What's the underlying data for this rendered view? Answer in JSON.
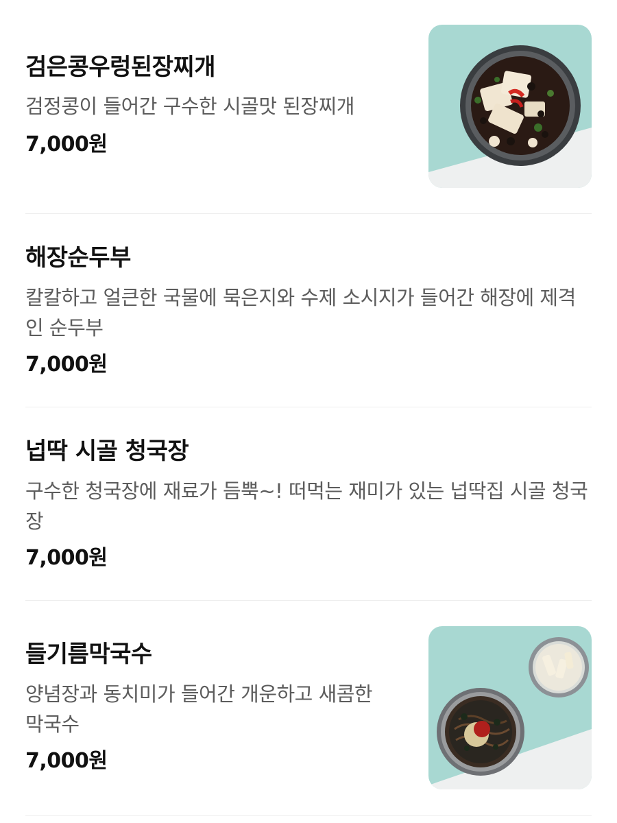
{
  "menu": {
    "items": [
      {
        "name": "검은콩우렁된장찌개",
        "description": "검정콩이 들어간 구수한 시골맛 된장찌개",
        "price": "7,000원"
      },
      {
        "name": "해장순두부",
        "description": "칼칼하고 얼큰한 국물에 묵은지와 수제 소시지가 들어간 해장에 제격인 순두부",
        "price": "7,000원"
      },
      {
        "name": "넙딱 시골 청국장",
        "description": "구수한 청국장에 재료가 듬뿍~! 떠먹는 재미가 있는 넙딱집 시골 청국장",
        "price": "7,000원"
      },
      {
        "name": "들기름막국수",
        "description": "양념장과 동치미가 들어간 개운하고 새콤한 막국수",
        "price": "7,000원"
      }
    ]
  },
  "colors": {
    "photo_background": "#a8d8d2",
    "text_primary": "#111111",
    "text_secondary": "#5c5c5c"
  }
}
